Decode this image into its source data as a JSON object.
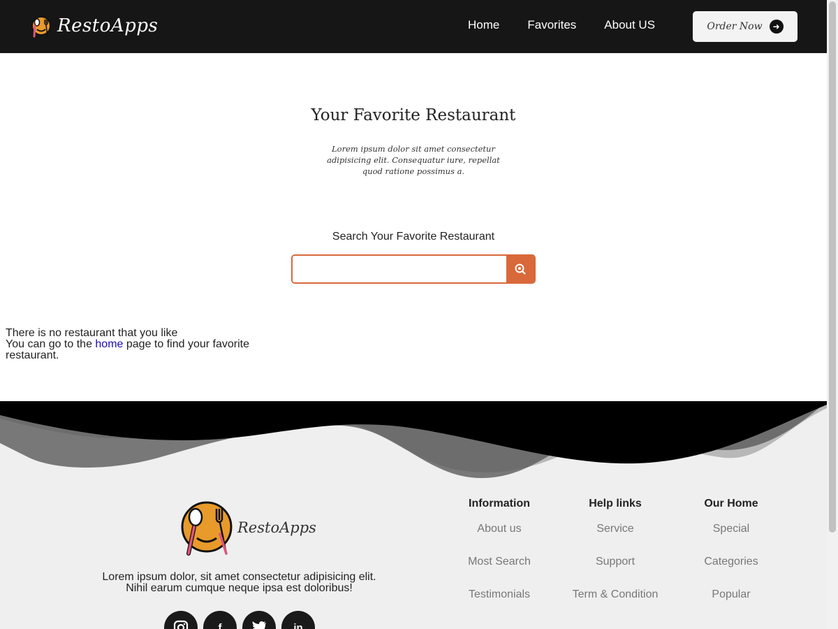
{
  "header": {
    "brand": "RestoApps",
    "nav": [
      {
        "label": "Home"
      },
      {
        "label": "Favorites"
      },
      {
        "label": "About US"
      }
    ],
    "order_button": "Order Now"
  },
  "hero": {
    "title": "Your Favorite Restaurant",
    "subtitle": "Lorem ipsum dolor sit amet consectetur adipisicing elit. Consequatur iure, repellat quod ratione possimus a."
  },
  "search": {
    "label": "Search Your Favorite Restaurant",
    "placeholder": "",
    "value": ""
  },
  "empty_state": {
    "line1": "There is no restaurant that you like",
    "line2_prefix": "You can go to the ",
    "link": "home",
    "line2_suffix": " page to find your favorite restaurant."
  },
  "footer": {
    "brand": "RestoApps",
    "description_line1": "Lorem ipsum dolor, sit amet consectetur adipisicing elit.",
    "description_line2": "Nihil earum cumque neque ipsa est doloribus!",
    "socials": [
      "instagram-icon",
      "facebook-icon",
      "twitter-icon",
      "linkedin-icon"
    ],
    "columns": [
      {
        "title": "Information",
        "links": [
          "About us",
          "Most Search",
          "Testimonials"
        ]
      },
      {
        "title": "Help links",
        "links": [
          "Service",
          "Support",
          "Term & Condition"
        ]
      },
      {
        "title": "Our Home",
        "links": [
          "Special",
          "Categories",
          "Popular"
        ]
      }
    ]
  },
  "colors": {
    "header_bg": "#161616",
    "accent": "#d9683a",
    "footer_bg": "#efefef"
  }
}
